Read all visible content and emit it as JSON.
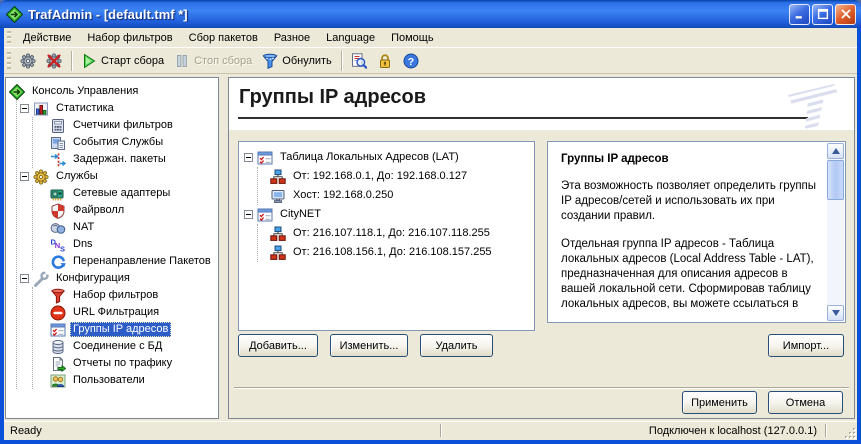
{
  "window": {
    "title": "TrafAdmin - [default.tmf *]"
  },
  "menubar": {
    "items": [
      "Действие",
      "Набор фильтров",
      "Сбор пакетов",
      "Разное",
      "Language",
      "Помощь"
    ]
  },
  "toolbar": {
    "buttons": [
      {
        "name": "connect",
        "icon": "gear",
        "label": "",
        "enabled": true
      },
      {
        "name": "disconnect",
        "icon": "gear-x",
        "label": "",
        "enabled": true
      },
      {
        "name": "separator"
      },
      {
        "name": "start-capture",
        "icon": "play",
        "label": "Старт сбора",
        "enabled": true
      },
      {
        "name": "stop-capture",
        "icon": "pause",
        "label": "Стоп сбора",
        "enabled": false
      },
      {
        "name": "reset",
        "icon": "funnel",
        "label": "Обнулить",
        "enabled": true
      },
      {
        "name": "separator"
      },
      {
        "name": "preview",
        "icon": "preview",
        "label": "",
        "enabled": true
      },
      {
        "name": "lock",
        "icon": "lock",
        "label": "",
        "enabled": true
      },
      {
        "name": "help",
        "icon": "help",
        "label": "",
        "enabled": true
      }
    ]
  },
  "sidebar": {
    "tree": {
      "label": "Консоль Управления",
      "icon": "console",
      "children": [
        {
          "label": "Статистика",
          "icon": "statistics",
          "expanded": true,
          "children": [
            {
              "label": "Счетчики фильтров",
              "icon": "counters"
            },
            {
              "label": "События Службы",
              "icon": "service-events"
            },
            {
              "label": "Задержан. пакеты",
              "icon": "delayed-packets"
            }
          ]
        },
        {
          "label": "Службы",
          "icon": "services",
          "expanded": true,
          "children": [
            {
              "label": "Сетевые адаптеры",
              "icon": "network-adapter"
            },
            {
              "label": "Файрволл",
              "icon": "firewall"
            },
            {
              "label": "NAT",
              "icon": "nat"
            },
            {
              "label": "Dns",
              "icon": "dns"
            },
            {
              "label": "Перенаправление Пакетов",
              "icon": "packet-redirect"
            }
          ]
        },
        {
          "label": "Конфигурация",
          "icon": "configuration",
          "expanded": true,
          "children": [
            {
              "label": "Набор фильтров",
              "icon": "filter-set"
            },
            {
              "label": "URL Фильтрация",
              "icon": "url-filter"
            },
            {
              "label": "Группы IP адресов",
              "icon": "ip-groups",
              "selected": true
            },
            {
              "label": "Соединение с БД",
              "icon": "database"
            },
            {
              "label": "Отчеты по трафику",
              "icon": "report"
            },
            {
              "label": "Пользователи",
              "icon": "users"
            }
          ]
        }
      ]
    }
  },
  "main": {
    "page_title": "Группы IP адресов",
    "group_list": [
      {
        "label": "Таблица Локальных Адресов (LAT)",
        "icon": "ip-groups",
        "expanded": true,
        "children": [
          {
            "label": "От: 192.168.0.1, До: 192.168.0.127",
            "icon": "range"
          },
          {
            "label": "Хост: 192.168.0.250",
            "icon": "host"
          }
        ]
      },
      {
        "label": "CityNET",
        "icon": "ip-groups",
        "expanded": true,
        "children": [
          {
            "label": "От: 216.107.118.1, До: 216.107.118.255",
            "icon": "range"
          },
          {
            "label": "От: 216.108.156.1, До: 216.108.157.255",
            "icon": "range"
          }
        ]
      }
    ],
    "buttons": {
      "add": "Добавить...",
      "edit": "Изменить...",
      "remove": "Удалить",
      "import": "Импорт...",
      "apply": "Применить",
      "cancel": "Отмена"
    },
    "description": {
      "title": "Группы IP адресов",
      "paragraphs": [
        "Эта возможность позволяет определить группы IP адресов/сетей и использовать их при создании правил.",
        "Отдельная группа IP адресов - Таблица локальных адресов (Local Address Table - LAT), предназначенная для описания адресов в вашей локальной сети. Сформировав таблицу локальных адресов, вы можете ссылаться в"
      ]
    }
  },
  "statusbar": {
    "left": "Ready",
    "connection": "Подключен к localhost (127.0.0.1)"
  },
  "colors": {
    "titlebar": "#2c6fe8",
    "selection": "#2d5dc7",
    "chrome": "#ECE9D8",
    "box_border": "#8398b8"
  }
}
